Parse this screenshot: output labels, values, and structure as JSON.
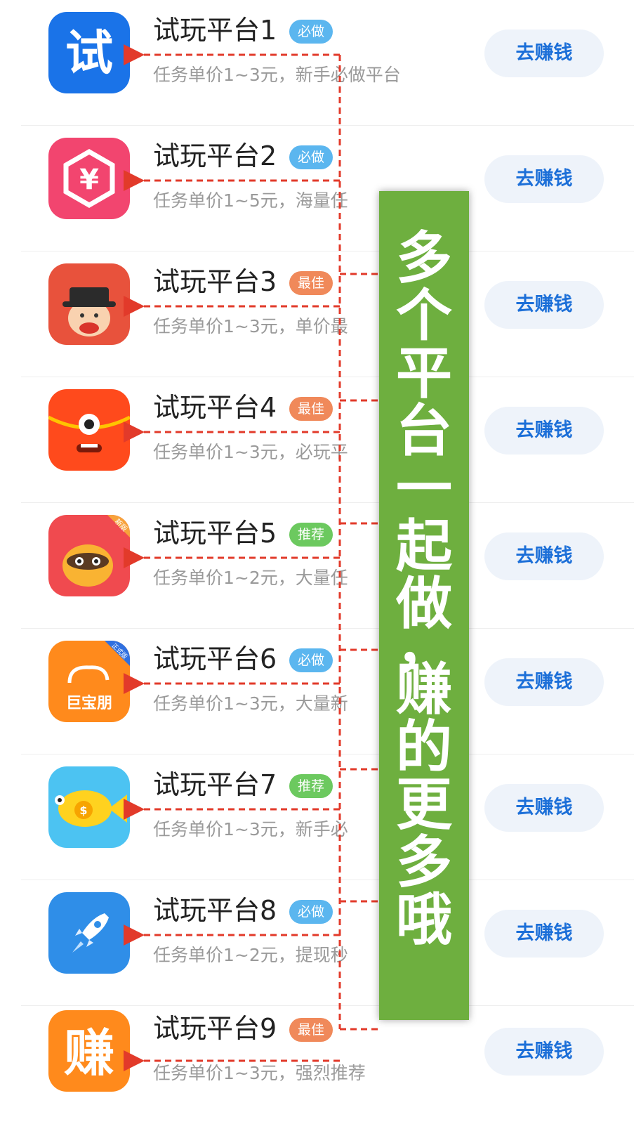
{
  "items": [
    {
      "title": "试玩平台1",
      "badge": "必做",
      "badge_color": "#5bb6ef",
      "desc": "任务单价1~3元，新手必做平台",
      "button": "去赚钱",
      "icon": "try-icon"
    },
    {
      "title": "试玩平台2",
      "badge": "必做",
      "badge_color": "#5bb6ef",
      "desc": "任务单价1~5元，海量任",
      "button": "去赚钱",
      "icon": "yuan-coin-icon"
    },
    {
      "title": "试玩平台3",
      "badge": "最佳",
      "badge_color": "#f0895a",
      "desc": "任务单价1~3元，单价最",
      "button": "去赚钱",
      "icon": "hat-face-icon"
    },
    {
      "title": "试玩平台4",
      "badge": "最佳",
      "badge_color": "#f0895a",
      "desc": "任务单价1~3元，必玩平",
      "button": "去赚钱",
      "icon": "red-envelope-monster-icon"
    },
    {
      "title": "试玩平台5",
      "badge": "推荐",
      "badge_color": "#6cc95f",
      "desc": "任务单价1~2元，大量任",
      "button": "去赚钱",
      "icon": "raccoon-icon"
    },
    {
      "title": "试玩平台6",
      "badge": "必做",
      "badge_color": "#5bb6ef",
      "desc": "任务单价1~3元，大量新",
      "button": "去赚钱",
      "icon": "jubaopeng-icon",
      "icon_text": "巨宝朋",
      "icon_corner": "正式版"
    },
    {
      "title": "试玩平台7",
      "badge": "推荐",
      "badge_color": "#6cc95f",
      "desc": "任务单价1~3元，新手必",
      "button": "去赚钱",
      "icon": "fish-coin-icon"
    },
    {
      "title": "试玩平台8",
      "badge": "必做",
      "badge_color": "#5bb6ef",
      "desc": "任务单价1~2元，提现秒",
      "button": "去赚钱",
      "icon": "rocket-icon"
    },
    {
      "title": "试玩平台9",
      "badge": "最佳",
      "badge_color": "#f0895a",
      "desc": "任务单价1~3元，强烈推荐",
      "button": "去赚钱",
      "icon": "zhuan-icon"
    }
  ],
  "icon_glyphs": {
    "try": "试",
    "zhuan": "赚",
    "jubaopeng_corner": "正式版",
    "raccoon_corner": "新版"
  },
  "banner": {
    "text_chars": [
      "多",
      "个",
      "平",
      "台",
      "一",
      "起",
      "做",
      "，",
      "赚",
      "的",
      "更",
      "多",
      "哦"
    ],
    "color": "#6eaf3f"
  },
  "connector_color": "#e23a2a"
}
